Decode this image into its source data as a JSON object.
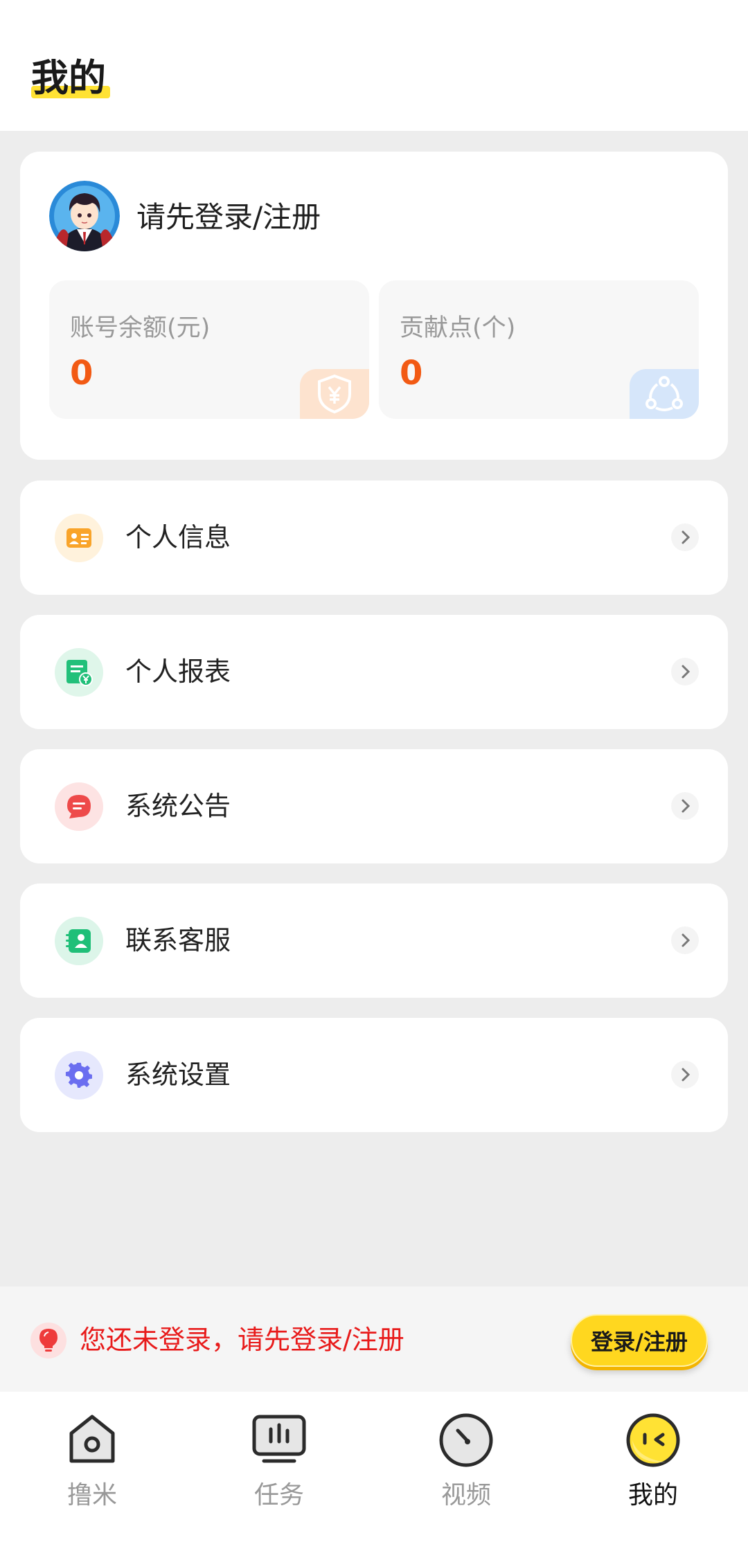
{
  "header": {
    "title": "我的"
  },
  "profile": {
    "login_prompt": "请先登录/注册",
    "balance": {
      "label": "账号余额(元)",
      "value": "0",
      "icon": "yuan-shield-icon"
    },
    "contribution": {
      "label": "贡献点(个)",
      "value": "0",
      "icon": "share-nodes-icon"
    }
  },
  "menu": {
    "items": [
      {
        "label": "个人信息",
        "icon": "id-card-icon",
        "color": "#f9a42a"
      },
      {
        "label": "个人报表",
        "icon": "report-yuan-icon",
        "color": "#22c07a"
      },
      {
        "label": "系统公告",
        "icon": "message-icon",
        "color": "#ee4a4a"
      },
      {
        "label": "联系客服",
        "icon": "customer-service-icon",
        "color": "#1fbf78"
      },
      {
        "label": "系统设置",
        "icon": "gear-icon",
        "color": "#6b6ef0"
      }
    ]
  },
  "banner": {
    "text": "您还未登录，请先登录/注册",
    "button_label": "登录/注册"
  },
  "tabbar": {
    "tabs": [
      {
        "label": "撸米",
        "icon": "home-icon"
      },
      {
        "label": "任务",
        "icon": "task-board-icon"
      },
      {
        "label": "视频",
        "icon": "video-dial-icon"
      },
      {
        "label": "我的",
        "icon": "face-icon",
        "active": true
      }
    ]
  }
}
